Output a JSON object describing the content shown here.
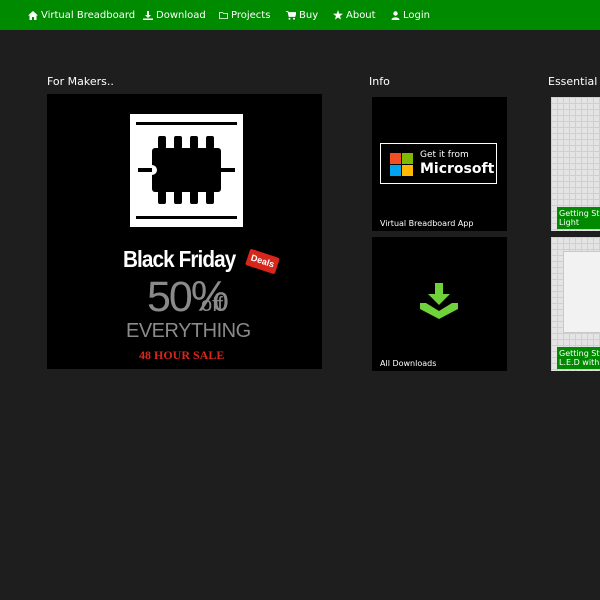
{
  "nav": {
    "items": [
      {
        "label": "Virtual Breadboard",
        "icon": "home-icon"
      },
      {
        "label": "Download",
        "icon": "download-icon"
      },
      {
        "label": "Projects",
        "icon": "folder-icon"
      },
      {
        "label": "Buy",
        "icon": "cart-icon"
      },
      {
        "label": "About",
        "icon": "star-icon"
      },
      {
        "label": "Login",
        "icon": "user-icon"
      }
    ]
  },
  "sections": {
    "makers": {
      "title": "For Makers..",
      "promo": {
        "headline": "Black Friday",
        "badge": "Deals",
        "percent": "50%",
        "off": "off",
        "everything": "EVERYTHING",
        "sale": "48 HOUR SALE"
      }
    },
    "info": {
      "title": "Info",
      "tiles": [
        {
          "caption": "Virtual Breadboard App",
          "badge_top": "Get it from",
          "badge_bottom": "Microsoft"
        },
        {
          "caption": "All Downloads"
        }
      ]
    },
    "essential": {
      "title": "Essential H",
      "tiles": [
        {
          "line1": "Getting Sta",
          "line2": "Light"
        },
        {
          "line1": "Getting Sta",
          "line2": "L.E.D with"
        }
      ]
    }
  },
  "colors": {
    "nav": "#008a00",
    "background": "#1e1e1e",
    "accent_green": "#6fd23a",
    "sale_red": "#d9261c"
  }
}
